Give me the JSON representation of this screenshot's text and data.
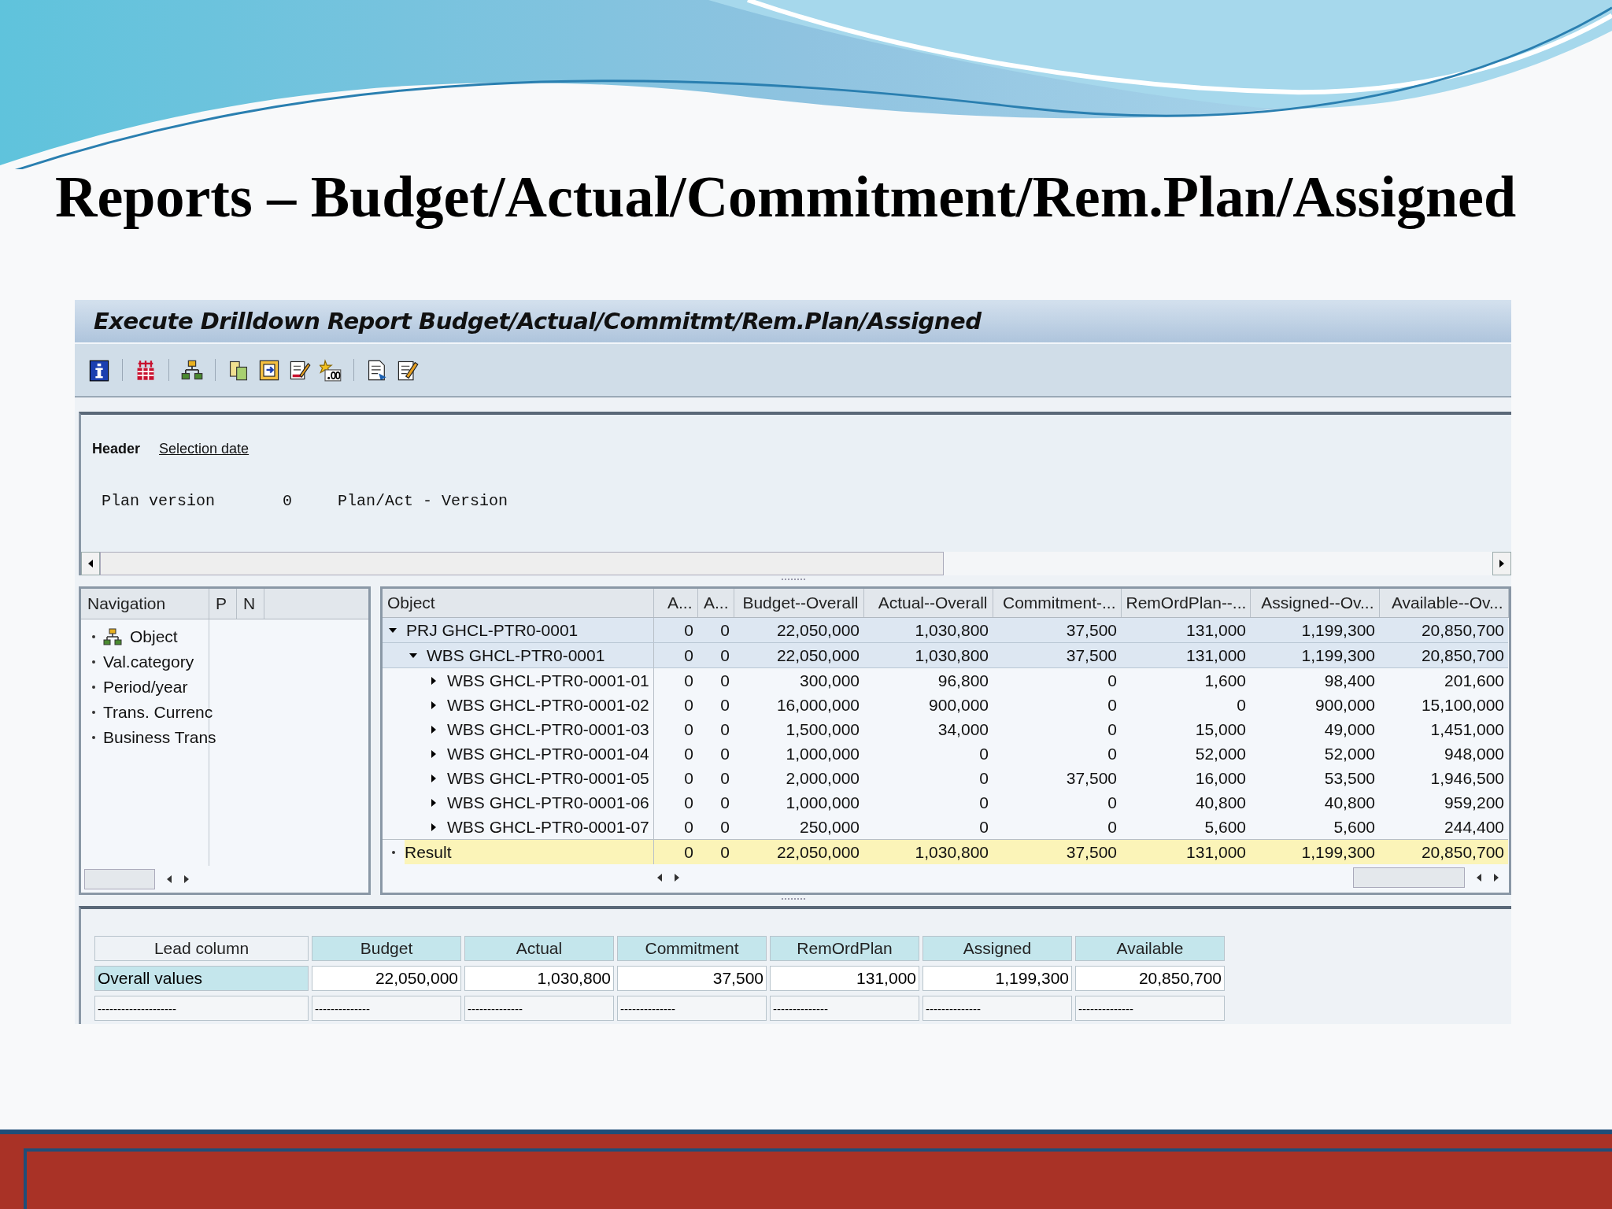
{
  "slide": {
    "title": "Reports – Budget/Actual/Commitment/Rem.Plan/Assigned"
  },
  "window": {
    "title": "Execute Drilldown Report Budget/Actual/Commitmt/Rem.Plan/Assigned"
  },
  "header_panel": {
    "tabs": [
      {
        "label": "Header",
        "selected": true
      },
      {
        "label": "Selection date",
        "selected": false
      }
    ],
    "fields": [
      {
        "label": "Plan version",
        "value": "0",
        "description": "Plan/Act - Version"
      }
    ]
  },
  "navigation": {
    "columns": [
      "Navigation",
      "P",
      "N"
    ],
    "items": [
      {
        "label": "Object",
        "active": true
      },
      {
        "label": "Val.category",
        "active": false
      },
      {
        "label": "Period/year",
        "active": false
      },
      {
        "label": "Trans. Currenc",
        "active": false
      },
      {
        "label": "Business Trans",
        "active": false
      }
    ]
  },
  "report_table": {
    "columns": [
      "Object",
      "A...",
      "A...",
      "Budget--Overall",
      "Actual--Overall",
      "Commitment-...",
      "RemOrdPlan--...",
      "Assigned--Ov...",
      "Available--Ov..."
    ],
    "rows": [
      {
        "label": "PRJ GHCL-PTR0-0001",
        "expanded": true,
        "values": [
          "0",
          "0",
          "22,050,000",
          "1,030,800",
          "37,500",
          "131,000",
          "1,199,300",
          "20,850,700"
        ],
        "children": [
          {
            "label": "WBS GHCL-PTR0-0001",
            "expanded": true,
            "values": [
              "0",
              "0",
              "22,050,000",
              "1,030,800",
              "37,500",
              "131,000",
              "1,199,300",
              "20,850,700"
            ],
            "children": [
              {
                "label": "WBS GHCL-PTR0-0001-01",
                "expanded": false,
                "values": [
                  "0",
                  "0",
                  "300,000",
                  "96,800",
                  "0",
                  "1,600",
                  "98,400",
                  "201,600"
                ]
              },
              {
                "label": "WBS GHCL-PTR0-0001-02",
                "expanded": false,
                "values": [
                  "0",
                  "0",
                  "16,000,000",
                  "900,000",
                  "0",
                  "0",
                  "900,000",
                  "15,100,000"
                ]
              },
              {
                "label": "WBS GHCL-PTR0-0001-03",
                "expanded": false,
                "values": [
                  "0",
                  "0",
                  "1,500,000",
                  "34,000",
                  "0",
                  "15,000",
                  "49,000",
                  "1,451,000"
                ]
              },
              {
                "label": "WBS GHCL-PTR0-0001-04",
                "expanded": false,
                "values": [
                  "0",
                  "0",
                  "1,000,000",
                  "0",
                  "0",
                  "52,000",
                  "52,000",
                  "948,000"
                ]
              },
              {
                "label": "WBS GHCL-PTR0-0001-05",
                "expanded": false,
                "values": [
                  "0",
                  "0",
                  "2,000,000",
                  "0",
                  "37,500",
                  "16,000",
                  "53,500",
                  "1,946,500"
                ]
              },
              {
                "label": "WBS GHCL-PTR0-0001-06",
                "expanded": false,
                "values": [
                  "0",
                  "0",
                  "1,000,000",
                  "0",
                  "0",
                  "40,800",
                  "40,800",
                  "959,200"
                ]
              },
              {
                "label": "WBS GHCL-PTR0-0001-07",
                "expanded": false,
                "values": [
                  "0",
                  "0",
                  "250,000",
                  "0",
                  "0",
                  "5,600",
                  "5,600",
                  "244,400"
                ]
              }
            ]
          }
        ]
      }
    ],
    "result": {
      "label": "Result",
      "values": [
        "0",
        "0",
        "22,050,000",
        "1,030,800",
        "37,500",
        "131,000",
        "1,199,300",
        "20,850,700"
      ]
    }
  },
  "summary_table": {
    "columns": [
      "Lead column",
      "Budget",
      "Actual",
      "Commitment",
      "RemOrdPlan",
      "Assigned",
      "Available"
    ],
    "rows": [
      {
        "kind": "values",
        "label": "Overall values",
        "values": [
          "22,050,000",
          "1,030,800",
          "37,500",
          "131,000",
          "1,199,300",
          "20,850,700"
        ]
      },
      {
        "kind": "separator",
        "label": "--------------------",
        "values": [
          "--------------",
          "--------------",
          "--------------",
          "--------------",
          "--------------",
          "--------------"
        ]
      }
    ]
  }
}
